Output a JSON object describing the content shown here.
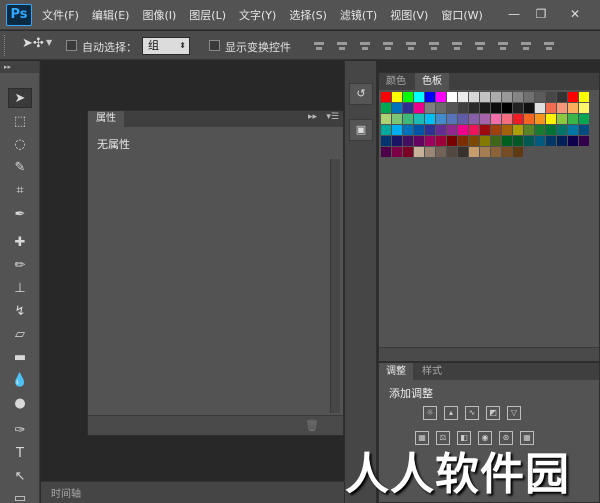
{
  "menubar": {
    "logo": "Ps",
    "items": [
      "文件(F)",
      "编辑(E)",
      "图像(I)",
      "图层(L)",
      "文字(Y)",
      "选择(S)",
      "滤镜(T)",
      "视图(V)",
      "窗口(W)"
    ],
    "minimize": "—",
    "restore": "❐",
    "close": "✕"
  },
  "options": {
    "auto_select_label": "自动选择：",
    "group_value": "组",
    "show_transform_label": "显示变换控件"
  },
  "properties_panel": {
    "tab": "属性",
    "content": "无属性"
  },
  "swatches_panel": {
    "tabs": [
      "颜色",
      "色板"
    ],
    "active_tab": "色板",
    "rows": [
      [
        "#ff0000",
        "#ffff00",
        "#00ff00",
        "#00ffff",
        "#0000ff",
        "#ff00ff",
        "#ffffff",
        "#ebebeb",
        "#d6d6d6",
        "#c2c2c2",
        "#adadad",
        "#999999",
        "#858585",
        "#707070",
        "#5c5c5c",
        "#474747",
        "#333333",
        "#ff0000",
        "#ffff00"
      ],
      [
        "#00a651",
        "#0072bc",
        "#2e3192",
        "#ec008c",
        "#7f7f7f",
        "#6a6a6a",
        "#555555",
        "#404040",
        "#2b2b2b",
        "#1a1a1a",
        "#0d0d0d",
        "#000000",
        "#222222",
        "#111111",
        "#e0e0e0",
        "#f26c4f",
        "#f7977a",
        "#fbaf5d",
        "#fff568"
      ],
      [
        "#acd373",
        "#7cc576",
        "#3cb878",
        "#1abbb4",
        "#00bff3",
        "#438ccb",
        "#5574b9",
        "#605ca8",
        "#855fa8",
        "#a763a9",
        "#f06eaa",
        "#f26d7d",
        "#ed1c24",
        "#f26522",
        "#f7941d",
        "#fff200",
        "#8dc63f",
        "#39b54a",
        "#00a651"
      ],
      [
        "#00a99d",
        "#00aeef",
        "#0072bc",
        "#0054a6",
        "#2e3192",
        "#662d91",
        "#92278f",
        "#ec008c",
        "#ed145b",
        "#9e0b0f",
        "#a0410d",
        "#a36209",
        "#aba000",
        "#598527",
        "#197b30",
        "#007236",
        "#00746b",
        "#0076a3",
        "#004b80"
      ],
      [
        "#003471",
        "#1b1464",
        "#440e62",
        "#630460",
        "#9e005d",
        "#9e0039",
        "#790000",
        "#7b2e00",
        "#7d4900",
        "#827b00",
        "#406618",
        "#005e20",
        "#005826",
        "#005952",
        "#005b7f",
        "#003663",
        "#002157",
        "#0d004c",
        "#32004b"
      ],
      [
        "#4b0049",
        "#7b0046",
        "#7a0026",
        "#c7b299",
        "#998675",
        "#736357",
        "#534741",
        "#37302d",
        "#c69c6d",
        "#a67c52",
        "#8c6239",
        "#754c24",
        "#603913",
        "#000000",
        "#000000",
        "#000000",
        "#000000",
        "#000000",
        "#000000"
      ]
    ],
    "row_counts": [
      19,
      19,
      19,
      19,
      19,
      13
    ]
  },
  "adjustments_panel": {
    "tabs": [
      "调整",
      "样式"
    ],
    "active_tab": "调整",
    "title": "添加调整",
    "row1_icons": [
      "brightness-icon",
      "levels-icon",
      "curves-icon",
      "exposure-icon",
      "vibrance-icon"
    ],
    "row2_icons": [
      "hue-saturation-icon",
      "color-balance-icon",
      "black-white-icon",
      "photo-filter-icon",
      "channel-mixer-icon",
      "color-lookup-icon"
    ]
  },
  "timeline": {
    "tab": "时间轴"
  },
  "watermark": "人人软件园"
}
